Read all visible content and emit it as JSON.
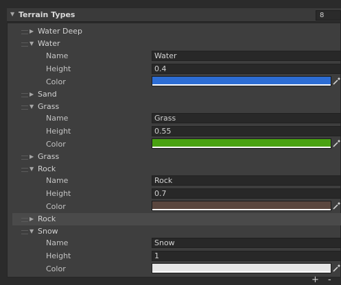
{
  "list": {
    "title": "Terrain Types",
    "count": "8",
    "items": [
      {
        "label": "Water Deep",
        "expanded": false
      },
      {
        "label": "Water",
        "expanded": true,
        "name_label": "Name",
        "name": "Water",
        "height_label": "Height",
        "height": "0.4",
        "color_label": "Color",
        "color": "#2d6dd4"
      },
      {
        "label": "Sand",
        "expanded": false
      },
      {
        "label": "Grass",
        "expanded": true,
        "name_label": "Name",
        "name": "Grass",
        "height_label": "Height",
        "height": "0.55",
        "color_label": "Color",
        "color": "#4aa212"
      },
      {
        "label": "Grass",
        "expanded": false
      },
      {
        "label": "Rock",
        "expanded": true,
        "name_label": "Name",
        "name": "Rock",
        "height_label": "Height",
        "height": "0.7",
        "color_label": "Color",
        "color": "#5a463e"
      },
      {
        "label": "Rock",
        "expanded": false,
        "selected": true
      },
      {
        "label": "Snow",
        "expanded": true,
        "name_label": "Name",
        "name": "Snow",
        "height_label": "Height",
        "height": "1",
        "color_label": "Color",
        "color": "#e6e6e6"
      }
    ],
    "add_label": "+",
    "remove_label": "-"
  }
}
